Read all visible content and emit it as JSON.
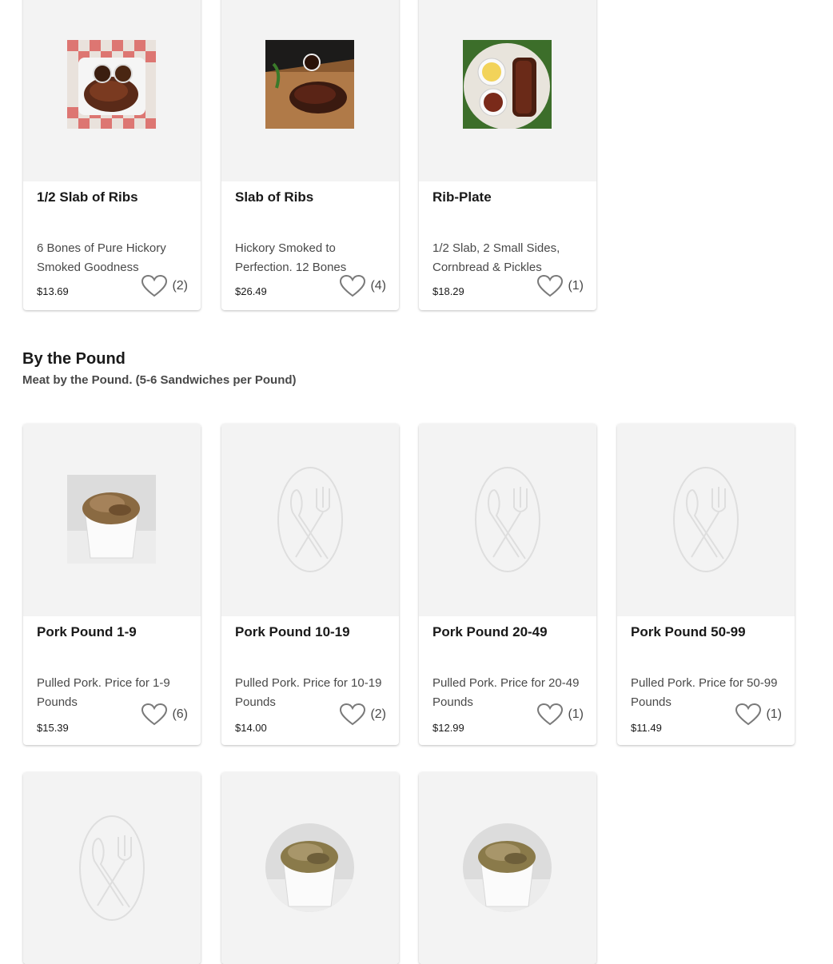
{
  "ribs": [
    {
      "name": "1/2 Slab of Ribs",
      "desc": "6 Bones of Pure Hickory Smoked Goodness",
      "price": "$13.69",
      "likes": "(2)"
    },
    {
      "name": "Slab of Ribs",
      "desc": "Hickory Smoked to Perfection. 12 Bones",
      "price": "$26.49",
      "likes": "(4)"
    },
    {
      "name": "Rib-Plate",
      "desc": "1/2 Slab, 2 Small Sides, Cornbread & Pickles",
      "price": "$18.29",
      "likes": "(1)"
    }
  ],
  "section": {
    "title": "By the Pound",
    "subtitle": "Meat by the Pound. (5-6 Sandwiches per Pound)"
  },
  "pound": [
    {
      "name": "Pork Pound 1-9",
      "desc": "Pulled Pork. Price for 1-9 Pounds",
      "price": "$15.39",
      "likes": "(6)"
    },
    {
      "name": "Pork Pound 10-19",
      "desc": "Pulled Pork. Price for 10-19 Pounds",
      "price": "$14.00",
      "likes": "(2)"
    },
    {
      "name": "Pork Pound 20-49",
      "desc": "Pulled Pork. Price for 20-49 Pounds",
      "price": "$12.99",
      "likes": "(1)"
    },
    {
      "name": "Pork Pound 50-99",
      "desc": "Pulled Pork. Price for 50-99 Pounds",
      "price": "$11.49",
      "likes": "(1)"
    }
  ],
  "icons": {
    "like": "heart-outline-icon",
    "placeholder": "plate-utensils-icon"
  }
}
